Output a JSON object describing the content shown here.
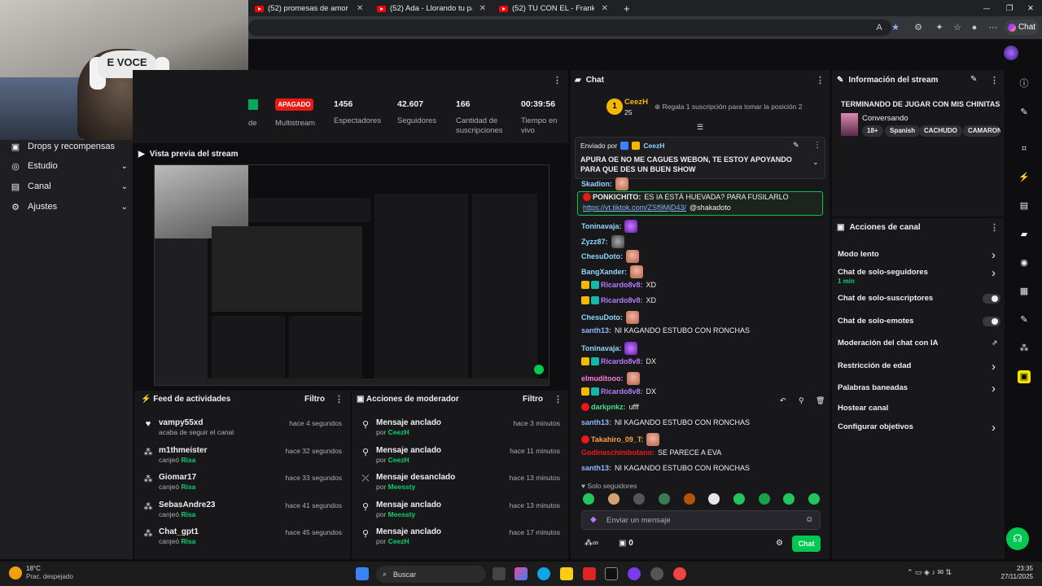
{
  "browser": {
    "tabs": [
      {
        "label": "(52) promesas de amor jhonny fi"
      },
      {
        "label": "(52) Ada - Llorando tu partida..el"
      },
      {
        "label": "(52) TU CON EL - Frankie Ruiz (L"
      }
    ],
    "chat_pill": "Chat"
  },
  "webcam": {
    "cap_text": "E VOCE"
  },
  "leftnav": {
    "items": [
      {
        "label": "Drops y recompensas"
      },
      {
        "label": "Estudio"
      },
      {
        "label": "Canal"
      },
      {
        "label": "Ajustes"
      }
    ]
  },
  "stats": {
    "partial_label": "de",
    "live_badge": "APAGADO",
    "multistream": "Multistream",
    "viewers_value": "1456",
    "viewers_label": "Espectadores",
    "followers_value": "42.607",
    "followers_label": "Seguidores",
    "subs_value": "166",
    "subs_label": "Cantidad de suscripciones",
    "time_value": "00:39:56",
    "time_label": "Tiempo en vivo"
  },
  "preview": {
    "title": "Vista previa del stream"
  },
  "feed": {
    "title": "Feed de actividades",
    "filter": "Filtro",
    "items": [
      {
        "name": "vampy55xd",
        "sub": "acaba de seguir el canal",
        "reward": "",
        "time": "hace 4 segundos",
        "icon": "heart-icon"
      },
      {
        "name": "m1thmeister",
        "sub": "canjeó",
        "reward": "Risa",
        "time": "hace 32 segundos",
        "icon": "points-icon"
      },
      {
        "name": "Giomar17",
        "sub": "canjeó",
        "reward": "Risa",
        "time": "hace 33 segundos",
        "icon": "points-icon"
      },
      {
        "name": "SebasAndre23",
        "sub": "canjeó",
        "reward": "Risa",
        "time": "hace 41 segundos",
        "icon": "points-icon"
      },
      {
        "name": "Chat_gpt1",
        "sub": "canjeó",
        "reward": "Risa",
        "time": "hace 45 segundos",
        "icon": "points-icon"
      }
    ]
  },
  "modactions": {
    "title": "Acciones de moderador",
    "filter": "Filtro",
    "items": [
      {
        "action": "Mensaje anclado",
        "by": "por",
        "who": "CeezH",
        "time": "hace 3 minutos"
      },
      {
        "action": "Mensaje anclado",
        "by": "por",
        "who": "CeezH",
        "time": "hace 11 minutos"
      },
      {
        "action": "Mensaje desanclado",
        "by": "por",
        "who": "Meessty",
        "time": "hace 13 minutos"
      },
      {
        "action": "Mensaje anclado",
        "by": "por",
        "who": "Meessty",
        "time": "hace 13 minutos"
      },
      {
        "action": "Mensaje anclado",
        "by": "por",
        "who": "CeezH",
        "time": "hace 17 minutos"
      }
    ]
  },
  "chat": {
    "title": "Chat",
    "hype_user": "CeezH",
    "hype_amount": "25",
    "hype_rank": "1",
    "hype_text": "Regala 1 suscripción para tomar la posición 2",
    "pinned_by_label": "Enviado por",
    "pinned_user": "CeezH",
    "pinned_text": "APURA OE NO ME CAGUES WEBON, TE ESTOY APOYANDO PARA QUE DES UN BUEN SHOW",
    "messages": [
      {
        "user": "Skadion:",
        "text": "",
        "color": "#8fd7ff",
        "emote": "face"
      },
      {
        "user": "PONKICHITO:",
        "text": "ES IA ESTÁ HUEVADA? PARA FUSILARLO",
        "color": "#efeff1",
        "emote": ""
      },
      {
        "user": "",
        "text": "@shakadoto",
        "color": "#efeff1",
        "emote": "",
        "link": "https://vt.tiktok.com/ZSf9MjD43/"
      },
      {
        "user": "Toninavaja:",
        "text": "",
        "color": "#8fd7ff",
        "emote": "purple"
      },
      {
        "user": "Zyzz87:",
        "text": "",
        "color": "#8fd7ff",
        "emote": "cat"
      },
      {
        "user": "ChesuDoto:",
        "text": "",
        "color": "#8fd7ff",
        "emote": "face"
      },
      {
        "user": "BangXander:",
        "text": "",
        "color": "#8fd7ff",
        "emote": "face"
      },
      {
        "user": "Ricardo8v8:",
        "text": "XD",
        "color": "#b57bff",
        "emote": ""
      },
      {
        "user": "Ricardo8v8:",
        "text": "XD",
        "color": "#b57bff",
        "emote": ""
      },
      {
        "user": "ChesuDoto:",
        "text": "",
        "color": "#8fd7ff",
        "emote": "face"
      },
      {
        "user": "santh13:",
        "text": "NI KAGANDO ESTUBO CON RONCHAS",
        "color": "#8fb8ff",
        "emote": ""
      },
      {
        "user": "Toninavaja:",
        "text": "",
        "color": "#8fd7ff",
        "emote": "purple"
      },
      {
        "user": "Ricardo8v8:",
        "text": "DX",
        "color": "#b57bff",
        "emote": ""
      },
      {
        "user": "elmuditooo:",
        "text": "",
        "color": "#ff7bd5",
        "emote": "face"
      },
      {
        "user": "Ricardo8v8:",
        "text": "DX",
        "color": "#b57bff",
        "emote": ""
      },
      {
        "user": "darkpnkz:",
        "text": "ufff",
        "color": "#4ade80",
        "emote": ""
      },
      {
        "user": "santh13:",
        "text": "NI KAGANDO ESTUBO CON RONCHAS",
        "color": "#8fb8ff",
        "emote": ""
      },
      {
        "user": "Takahiro_09_T:",
        "text": "",
        "color": "#ff9f43",
        "emote": "face"
      },
      {
        "user": "Godinaschimbotano:",
        "text": "SE PARECE A EVA",
        "color": "#e91916",
        "emote": ""
      },
      {
        "user": "santh13:",
        "text": "NI KAGANDO ESTUBO CON RONCHAS",
        "color": "#8fb8ff",
        "emote": ""
      }
    ],
    "followers_only": "Solo seguidores",
    "input_placeholder": "Enviar un mensaje",
    "points": "0",
    "send_label": "Chat"
  },
  "info": {
    "title": "Información del stream",
    "stream_title": "TERMINANDO DE JUGAR CON MIS CHINITAS",
    "category": "Conversando",
    "tags": [
      "18+",
      "Spanish",
      "CACHUDO",
      "CAMARON"
    ]
  },
  "channel_actions": {
    "title": "Acciones de canal",
    "items": [
      {
        "label": "Modo lento",
        "sub": "",
        "control": "chevron"
      },
      {
        "label": "Chat de solo-seguidores",
        "sub": "1 min",
        "control": "chevron"
      },
      {
        "label": "Chat de solo-suscriptores",
        "sub": "",
        "control": "toggle"
      },
      {
        "label": "Chat de solo-emotes",
        "sub": "",
        "control": "toggle"
      },
      {
        "label": "Moderación del chat con IA",
        "sub": "",
        "control": "external"
      },
      {
        "label": "Restricción de edad",
        "sub": "",
        "control": "chevron"
      },
      {
        "label": "Palabras baneadas",
        "sub": "",
        "control": "chevron"
      },
      {
        "label": "Hostear canal",
        "sub": "",
        "control": "none"
      },
      {
        "label": "Configurar objetivos",
        "sub": "",
        "control": "chevron"
      }
    ]
  },
  "taskbar": {
    "weather_temp": "18°C",
    "weather_desc": "Prac. despejado",
    "search": "Buscar",
    "time": "23:35",
    "date": "27/11/2025"
  },
  "colors": {
    "accent_green": "#00c853",
    "live_red": "#e91916",
    "panel": "#18181b",
    "background": "#0e0e10"
  }
}
